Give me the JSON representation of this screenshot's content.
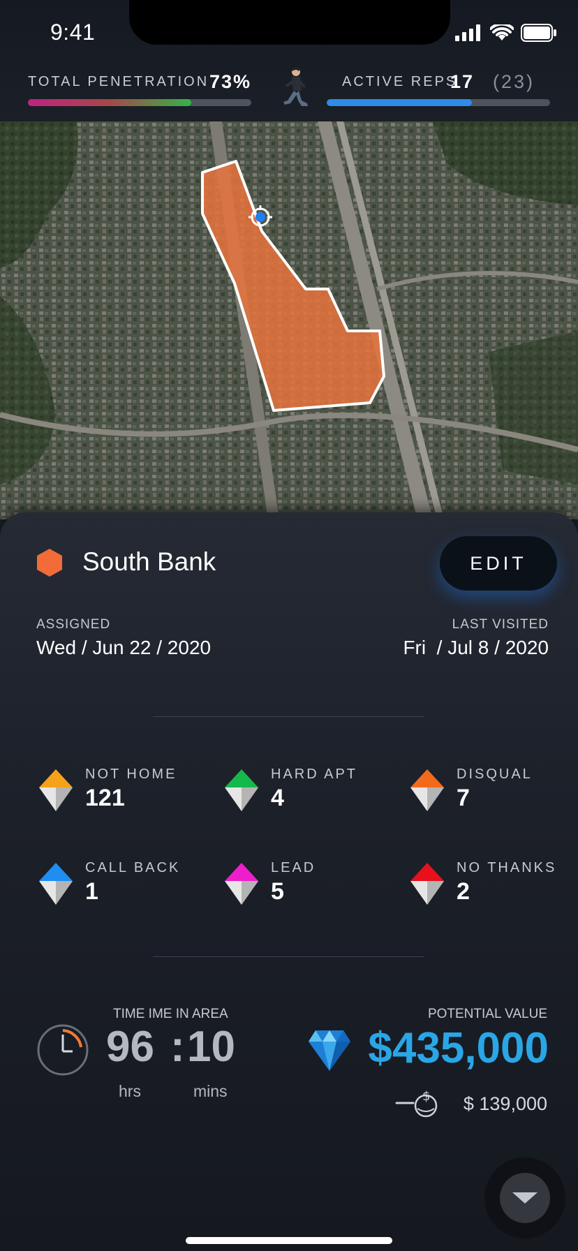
{
  "status_bar": {
    "time": "9:41"
  },
  "header": {
    "penetration_label": "TOTAL PENETRATION",
    "penetration_value": "73%",
    "penetration_progress": 0.73,
    "active_reps_label": "ACTIVE REPS",
    "active_reps_value": "17",
    "active_reps_total": "(23)",
    "active_reps_progress": 0.65,
    "runner_icon": "runner-icon"
  },
  "area": {
    "name": "South Bank",
    "color": "#f26b38",
    "edit_label": "EDIT",
    "assigned_label": "ASSIGNED",
    "assigned_date": "Wed / Jun 22 / 2020",
    "last_visited_label": "LAST VISITED",
    "last_visited_date": "Fri  / Jul 8 / 2020"
  },
  "stats": [
    {
      "label": "NOT HOME",
      "value": "121",
      "color": "#f5a21b"
    },
    {
      "label": "HARD APT",
      "value": "4",
      "color": "#15b84a"
    },
    {
      "label": "DISQUAL",
      "value": "7",
      "color": "#f46a1b"
    },
    {
      "label": "CALL BACK",
      "value": "1",
      "color": "#1e8ef0"
    },
    {
      "label": "LEAD",
      "value": "5",
      "color": "#ef1ecb"
    },
    {
      "label": "NO THANKS",
      "value": "2",
      "color": "#e8101c"
    }
  ],
  "time_in_area": {
    "label": "TIME IME IN AREA",
    "hours": "96",
    "separator": ":",
    "minutes": "10",
    "hours_unit": "hrs",
    "minutes_unit": "mins"
  },
  "potential_value": {
    "label": "POTENTIAL VALUE",
    "value": "$435,000",
    "commission": "$ 139,000",
    "accent": "#2aa6e6"
  }
}
